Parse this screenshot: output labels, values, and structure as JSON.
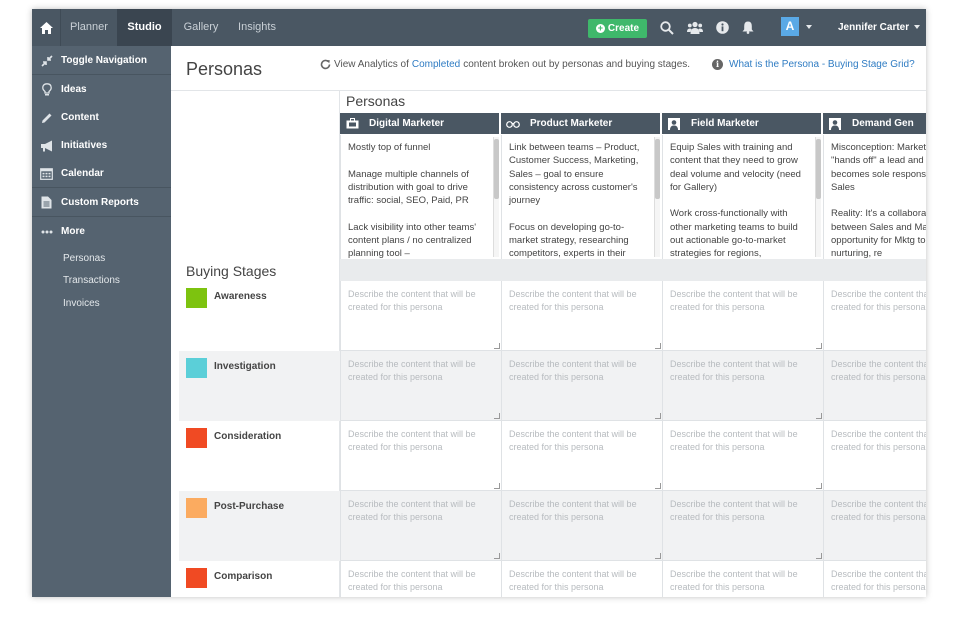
{
  "topbar": {
    "tabs": [
      {
        "label": "Planner",
        "active": false
      },
      {
        "label": "Studio",
        "active": true
      },
      {
        "label": "Gallery",
        "active": false
      },
      {
        "label": "Insights",
        "active": false
      }
    ],
    "create_label": "Create",
    "avatar_letter": "A",
    "user_name": "Jennifer Carter",
    "icons": [
      "home-icon",
      "search-icon",
      "team-icon",
      "info-icon",
      "bell-icon"
    ]
  },
  "sidebar": {
    "items": [
      {
        "label": "Toggle Navigation",
        "icon": "collapse-icon"
      },
      {
        "label": "Ideas",
        "icon": "lightbulb-icon"
      },
      {
        "label": "Content",
        "icon": "pencil-icon"
      },
      {
        "label": "Initiatives",
        "icon": "megaphone-icon"
      },
      {
        "label": "Calendar",
        "icon": "calendar-icon"
      },
      {
        "label": "Custom Reports",
        "icon": "report-icon"
      },
      {
        "label": "More",
        "icon": "more-icon"
      }
    ],
    "sub_items": [
      "Personas",
      "Transactions",
      "Invoices"
    ]
  },
  "header": {
    "title": "Personas",
    "analytics_prefix": "View Analytics of",
    "analytics_link": "Completed",
    "analytics_suffix": "content broken out by personas and buying stages.",
    "grid_link": "What is the Persona - Buying Stage Grid?"
  },
  "grid": {
    "personas_heading": "Personas",
    "buying_stages_heading": "Buying Stages",
    "personas": [
      {
        "name": "Digital Marketer",
        "icon": "briefcase-icon",
        "description": "Mostly top of funnel\n\nManage multiple channels of distribution with goal to drive traffic: social, SEO, Paid, PR\n\nLack visibility into other teams' content plans / no centralized planning tool –"
      },
      {
        "name": "Product Marketer",
        "icon": "glasses-icon",
        "description": "Link between teams – Product, Customer Success, Marketing, Sales – goal to ensure consistency across customer's journey\n\nFocus on developing go-to-market strategy, researching competitors, experts in their"
      },
      {
        "name": "Field Marketer",
        "icon": "person-icon",
        "description": "Equip Sales with training and content that they need to grow deal volume and velocity (need for Gallery)\n\nWork cross-functionally with other marketing teams to build out actionable go-to-market strategies for regions,"
      },
      {
        "name": "Demand Gen",
        "icon": "person-icon",
        "description": "Misconception: Marketing \"hands off\" a lead and it becomes sole responsibility of Sales\n\nReality: It's a collaboration between Sales and Marketing opportunity for Mktg to continue nurturing, re"
      }
    ],
    "stages": [
      {
        "name": "Awareness",
        "color": "#7dc30f"
      },
      {
        "name": "Investigation",
        "color": "#5bcfd8"
      },
      {
        "name": "Consideration",
        "color": "#f04a23"
      },
      {
        "name": "Post-Purchase",
        "color": "#fbab60"
      },
      {
        "name": "Comparison",
        "color": "#f04a23"
      }
    ],
    "cell_placeholder_line1": "Describe the content that will be",
    "cell_placeholder_line2": "created for this persona"
  }
}
